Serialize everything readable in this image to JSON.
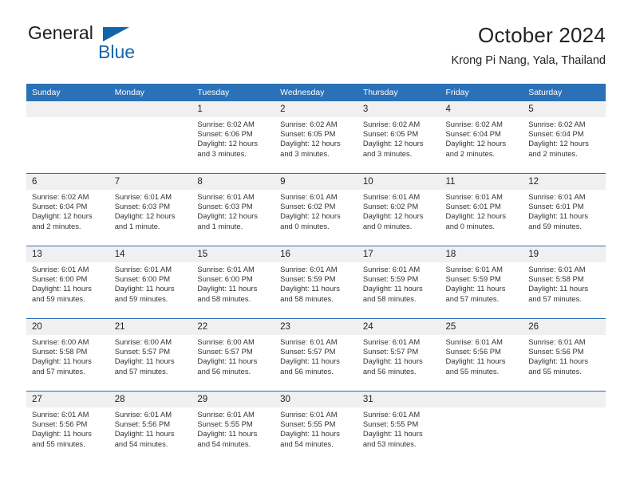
{
  "brand": {
    "name_top": "General",
    "name_bottom": "Blue",
    "triangle_color": "#1464aa",
    "top_color": "#1d1d1d",
    "bottom_color": "#1464aa"
  },
  "header": {
    "title": "October 2024",
    "subtitle": "Krong Pi Nang, Yala, Thailand"
  },
  "theme": {
    "header_bg": "#2a71b8",
    "header_text": "#ffffff",
    "daynum_bg": "#f0f0f0",
    "row_divider": "#2a71b8",
    "body_text": "#333333"
  },
  "weekday_headers": [
    "Sunday",
    "Monday",
    "Tuesday",
    "Wednesday",
    "Thursday",
    "Friday",
    "Saturday"
  ],
  "labels": {
    "sunrise_prefix": "Sunrise:",
    "sunset_prefix": "Sunset:",
    "daylight_prefix": "Daylight:"
  },
  "weeks": [
    [
      {
        "day": "",
        "blank": true,
        "line1": "",
        "line2": "",
        "line3": "",
        "line4": ""
      },
      {
        "day": "",
        "blank": true,
        "line1": "",
        "line2": "",
        "line3": "",
        "line4": ""
      },
      {
        "day": "1",
        "blank": false,
        "line1": "Sunrise: 6:02 AM",
        "line2": "Sunset: 6:06 PM",
        "line3": "Daylight: 12 hours",
        "line4": "and 3 minutes."
      },
      {
        "day": "2",
        "blank": false,
        "line1": "Sunrise: 6:02 AM",
        "line2": "Sunset: 6:05 PM",
        "line3": "Daylight: 12 hours",
        "line4": "and 3 minutes."
      },
      {
        "day": "3",
        "blank": false,
        "line1": "Sunrise: 6:02 AM",
        "line2": "Sunset: 6:05 PM",
        "line3": "Daylight: 12 hours",
        "line4": "and 3 minutes."
      },
      {
        "day": "4",
        "blank": false,
        "line1": "Sunrise: 6:02 AM",
        "line2": "Sunset: 6:04 PM",
        "line3": "Daylight: 12 hours",
        "line4": "and 2 minutes."
      },
      {
        "day": "5",
        "blank": false,
        "line1": "Sunrise: 6:02 AM",
        "line2": "Sunset: 6:04 PM",
        "line3": "Daylight: 12 hours",
        "line4": "and 2 minutes."
      }
    ],
    [
      {
        "day": "6",
        "blank": false,
        "line1": "Sunrise: 6:02 AM",
        "line2": "Sunset: 6:04 PM",
        "line3": "Daylight: 12 hours",
        "line4": "and 2 minutes."
      },
      {
        "day": "7",
        "blank": false,
        "line1": "Sunrise: 6:01 AM",
        "line2": "Sunset: 6:03 PM",
        "line3": "Daylight: 12 hours",
        "line4": "and 1 minute."
      },
      {
        "day": "8",
        "blank": false,
        "line1": "Sunrise: 6:01 AM",
        "line2": "Sunset: 6:03 PM",
        "line3": "Daylight: 12 hours",
        "line4": "and 1 minute."
      },
      {
        "day": "9",
        "blank": false,
        "line1": "Sunrise: 6:01 AM",
        "line2": "Sunset: 6:02 PM",
        "line3": "Daylight: 12 hours",
        "line4": "and 0 minutes."
      },
      {
        "day": "10",
        "blank": false,
        "line1": "Sunrise: 6:01 AM",
        "line2": "Sunset: 6:02 PM",
        "line3": "Daylight: 12 hours",
        "line4": "and 0 minutes."
      },
      {
        "day": "11",
        "blank": false,
        "line1": "Sunrise: 6:01 AM",
        "line2": "Sunset: 6:01 PM",
        "line3": "Daylight: 12 hours",
        "line4": "and 0 minutes."
      },
      {
        "day": "12",
        "blank": false,
        "line1": "Sunrise: 6:01 AM",
        "line2": "Sunset: 6:01 PM",
        "line3": "Daylight: 11 hours",
        "line4": "and 59 minutes."
      }
    ],
    [
      {
        "day": "13",
        "blank": false,
        "line1": "Sunrise: 6:01 AM",
        "line2": "Sunset: 6:00 PM",
        "line3": "Daylight: 11 hours",
        "line4": "and 59 minutes."
      },
      {
        "day": "14",
        "blank": false,
        "line1": "Sunrise: 6:01 AM",
        "line2": "Sunset: 6:00 PM",
        "line3": "Daylight: 11 hours",
        "line4": "and 59 minutes."
      },
      {
        "day": "15",
        "blank": false,
        "line1": "Sunrise: 6:01 AM",
        "line2": "Sunset: 6:00 PM",
        "line3": "Daylight: 11 hours",
        "line4": "and 58 minutes."
      },
      {
        "day": "16",
        "blank": false,
        "line1": "Sunrise: 6:01 AM",
        "line2": "Sunset: 5:59 PM",
        "line3": "Daylight: 11 hours",
        "line4": "and 58 minutes."
      },
      {
        "day": "17",
        "blank": false,
        "line1": "Sunrise: 6:01 AM",
        "line2": "Sunset: 5:59 PM",
        "line3": "Daylight: 11 hours",
        "line4": "and 58 minutes."
      },
      {
        "day": "18",
        "blank": false,
        "line1": "Sunrise: 6:01 AM",
        "line2": "Sunset: 5:59 PM",
        "line3": "Daylight: 11 hours",
        "line4": "and 57 minutes."
      },
      {
        "day": "19",
        "blank": false,
        "line1": "Sunrise: 6:01 AM",
        "line2": "Sunset: 5:58 PM",
        "line3": "Daylight: 11 hours",
        "line4": "and 57 minutes."
      }
    ],
    [
      {
        "day": "20",
        "blank": false,
        "line1": "Sunrise: 6:00 AM",
        "line2": "Sunset: 5:58 PM",
        "line3": "Daylight: 11 hours",
        "line4": "and 57 minutes."
      },
      {
        "day": "21",
        "blank": false,
        "line1": "Sunrise: 6:00 AM",
        "line2": "Sunset: 5:57 PM",
        "line3": "Daylight: 11 hours",
        "line4": "and 57 minutes."
      },
      {
        "day": "22",
        "blank": false,
        "line1": "Sunrise: 6:00 AM",
        "line2": "Sunset: 5:57 PM",
        "line3": "Daylight: 11 hours",
        "line4": "and 56 minutes."
      },
      {
        "day": "23",
        "blank": false,
        "line1": "Sunrise: 6:01 AM",
        "line2": "Sunset: 5:57 PM",
        "line3": "Daylight: 11 hours",
        "line4": "and 56 minutes."
      },
      {
        "day": "24",
        "blank": false,
        "line1": "Sunrise: 6:01 AM",
        "line2": "Sunset: 5:57 PM",
        "line3": "Daylight: 11 hours",
        "line4": "and 56 minutes."
      },
      {
        "day": "25",
        "blank": false,
        "line1": "Sunrise: 6:01 AM",
        "line2": "Sunset: 5:56 PM",
        "line3": "Daylight: 11 hours",
        "line4": "and 55 minutes."
      },
      {
        "day": "26",
        "blank": false,
        "line1": "Sunrise: 6:01 AM",
        "line2": "Sunset: 5:56 PM",
        "line3": "Daylight: 11 hours",
        "line4": "and 55 minutes."
      }
    ],
    [
      {
        "day": "27",
        "blank": false,
        "line1": "Sunrise: 6:01 AM",
        "line2": "Sunset: 5:56 PM",
        "line3": "Daylight: 11 hours",
        "line4": "and 55 minutes."
      },
      {
        "day": "28",
        "blank": false,
        "line1": "Sunrise: 6:01 AM",
        "line2": "Sunset: 5:56 PM",
        "line3": "Daylight: 11 hours",
        "line4": "and 54 minutes."
      },
      {
        "day": "29",
        "blank": false,
        "line1": "Sunrise: 6:01 AM",
        "line2": "Sunset: 5:55 PM",
        "line3": "Daylight: 11 hours",
        "line4": "and 54 minutes."
      },
      {
        "day": "30",
        "blank": false,
        "line1": "Sunrise: 6:01 AM",
        "line2": "Sunset: 5:55 PM",
        "line3": "Daylight: 11 hours",
        "line4": "and 54 minutes."
      },
      {
        "day": "31",
        "blank": false,
        "line1": "Sunrise: 6:01 AM",
        "line2": "Sunset: 5:55 PM",
        "line3": "Daylight: 11 hours",
        "line4": "and 53 minutes."
      },
      {
        "day": "",
        "blank": true,
        "line1": "",
        "line2": "",
        "line3": "",
        "line4": ""
      },
      {
        "day": "",
        "blank": true,
        "line1": "",
        "line2": "",
        "line3": "",
        "line4": ""
      }
    ]
  ]
}
